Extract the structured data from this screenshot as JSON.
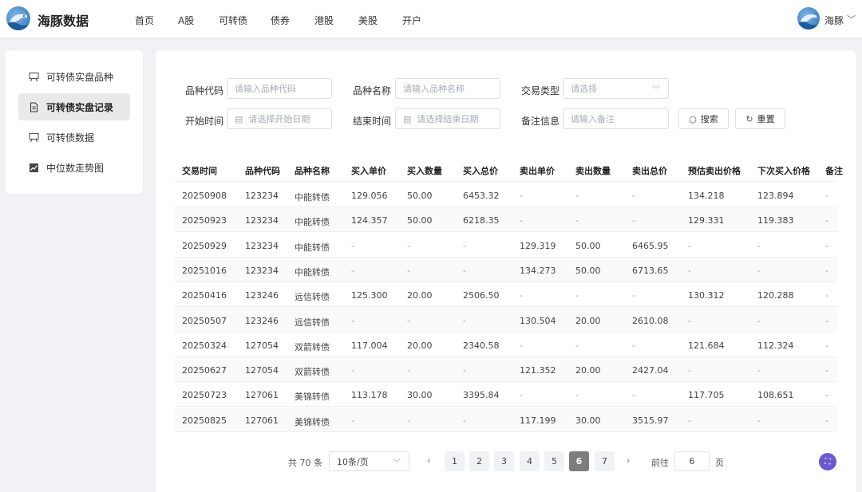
{
  "header": {
    "brand": "海豚数据",
    "nav": [
      "首页",
      "A股",
      "可转债",
      "债券",
      "港股",
      "美股",
      "开户"
    ],
    "user_name": "海豚",
    "user_caret": "﹀"
  },
  "sidebar": {
    "items": [
      {
        "label": "可转债实盘品种",
        "icon": "board-icon",
        "active": false
      },
      {
        "label": "可转债实盘记录",
        "icon": "document-icon",
        "active": true
      },
      {
        "label": "可转债数据",
        "icon": "board-icon",
        "active": false
      },
      {
        "label": "中位数走势图",
        "icon": "trend-chart-icon",
        "active": false
      }
    ]
  },
  "filters": {
    "code_label": "品种代码",
    "code_placeholder": "请输入品种代码",
    "name_label": "品种名称",
    "name_placeholder": "请输入品种名称",
    "type_label": "交易类型",
    "type_placeholder": "请选择",
    "start_label": "开始时间",
    "start_placeholder": "请选择开始日期",
    "end_label": "结束时间",
    "end_placeholder": "请选择结束日期",
    "note_label": "备注信息",
    "note_placeholder": "请输入备注",
    "search_label": "搜索",
    "reset_label": "重置"
  },
  "table": {
    "headers": [
      "交易时间",
      "品种代码",
      "品种名称",
      "买入单价",
      "买入数量",
      "买入总价",
      "卖出单价",
      "卖出数量",
      "卖出总价",
      "预估卖出价格",
      "下次买入价格",
      "备注"
    ],
    "rows": [
      [
        "20250908",
        "123234",
        "中能转债",
        "129.056",
        "50.00",
        "6453.32",
        "-",
        "-",
        "-",
        "134.218",
        "123.894",
        "-"
      ],
      [
        "20250923",
        "123234",
        "中能转债",
        "124.357",
        "50.00",
        "6218.35",
        "-",
        "-",
        "-",
        "129.331",
        "119.383",
        "-"
      ],
      [
        "20250929",
        "123234",
        "中能转债",
        "-",
        "-",
        "-",
        "129.319",
        "50.00",
        "6465.95",
        "-",
        "-",
        "-"
      ],
      [
        "20251016",
        "123234",
        "中能转债",
        "-",
        "-",
        "-",
        "134.273",
        "50.00",
        "6713.65",
        "-",
        "-",
        "-"
      ],
      [
        "20250416",
        "123246",
        "远信转债",
        "125.300",
        "20.00",
        "2506.50",
        "-",
        "-",
        "-",
        "130.312",
        "120.288",
        "-"
      ],
      [
        "20250507",
        "123246",
        "远信转债",
        "-",
        "-",
        "-",
        "130.504",
        "20.00",
        "2610.08",
        "-",
        "-",
        "-"
      ],
      [
        "20250324",
        "127054",
        "双箭转债",
        "117.004",
        "20.00",
        "2340.58",
        "-",
        "-",
        "-",
        "121.684",
        "112.324",
        "-"
      ],
      [
        "20250627",
        "127054",
        "双箭转债",
        "-",
        "-",
        "-",
        "121.352",
        "20.00",
        "2427.04",
        "-",
        "-",
        "-"
      ],
      [
        "20250723",
        "127061",
        "美锦转债",
        "113.178",
        "30.00",
        "3395.84",
        "-",
        "-",
        "-",
        "117.705",
        "108.651",
        "-"
      ],
      [
        "20250825",
        "127061",
        "美锦转债",
        "-",
        "-",
        "-",
        "117.199",
        "30.00",
        "3515.97",
        "-",
        "-",
        "-"
      ]
    ]
  },
  "pagination": {
    "total": "共 70 条",
    "page_size": "10条/页",
    "prev": "‹",
    "next": "›",
    "pages": [
      "1",
      "2",
      "3",
      "4",
      "5",
      "6",
      "7"
    ],
    "current": "6",
    "goto_label": "前往",
    "goto_value": "6",
    "page_suffix": "页"
  }
}
